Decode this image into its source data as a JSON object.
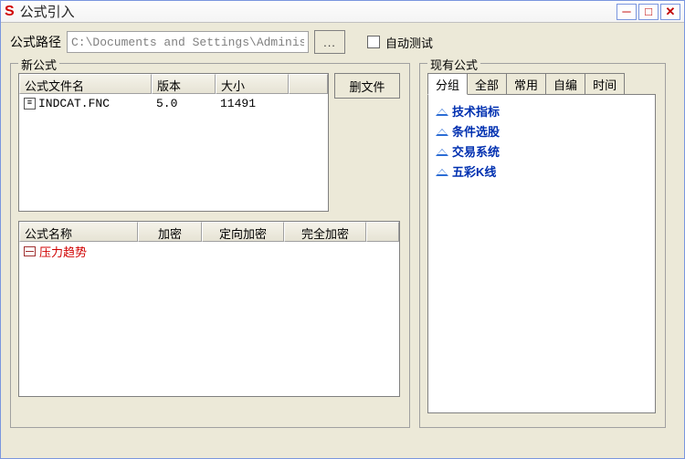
{
  "window": {
    "icon_letter": "S",
    "title": "公式引入"
  },
  "path": {
    "label": "公式路径",
    "value": "C:\\Documents and Settings\\Administ",
    "browse_label": "...",
    "checkbox_label": "自动测试"
  },
  "left": {
    "legend": "新公式",
    "file_headers": [
      "公式文件名",
      "版本",
      "大小"
    ],
    "files": [
      {
        "name": "INDCAT.FNC",
        "version": "5.0",
        "size": "11491"
      }
    ],
    "delete_label": "删文件",
    "formula_headers": [
      "公式名称",
      "加密",
      "定向加密",
      "完全加密"
    ],
    "formulas": [
      {
        "name": "压力趋势"
      }
    ]
  },
  "right": {
    "legend": "现有公式",
    "tabs": [
      "分组",
      "全部",
      "常用",
      "自编",
      "时间"
    ],
    "active_tab": 0,
    "groups": [
      "技术指标",
      "条件选股",
      "交易系统",
      "五彩K线"
    ]
  }
}
